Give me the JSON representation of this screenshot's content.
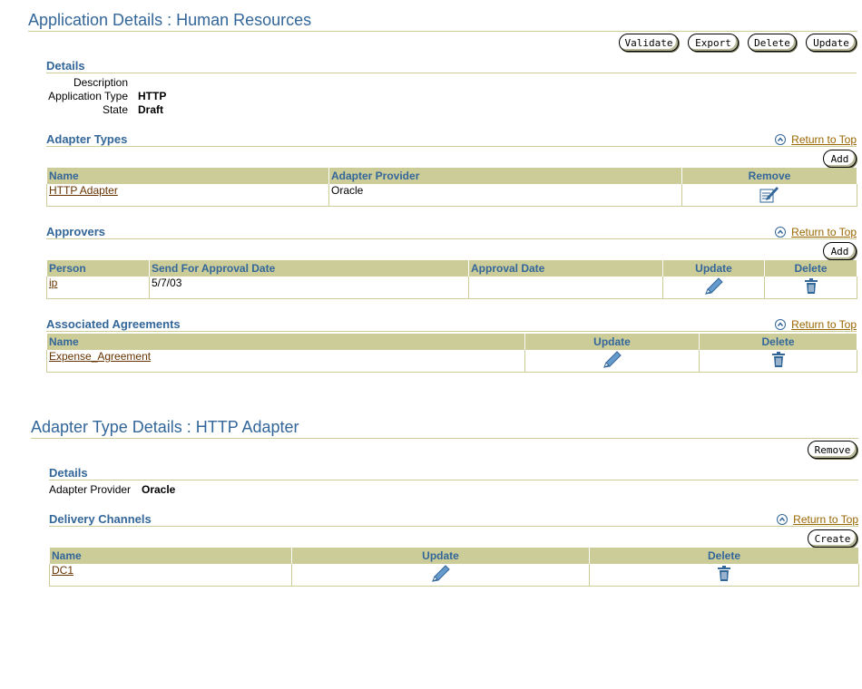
{
  "app_details": {
    "title": "Application Details : Human Resources",
    "buttons": {
      "validate": "Validate",
      "export": "Export",
      "delete": "Delete",
      "update": "Update"
    },
    "details": {
      "header": "Details",
      "description_label": "Description",
      "description_value": "",
      "type_label": "Application Type",
      "type_value": "HTTP",
      "state_label": "State",
      "state_value": "Draft"
    },
    "adapter_types": {
      "header": "Adapter Types",
      "return_to_top": "Return to Top",
      "add": "Add",
      "columns": [
        "Name",
        "Adapter Provider",
        "Remove"
      ],
      "rows": [
        {
          "name": "HTTP Adapter",
          "provider": "Oracle"
        }
      ]
    },
    "approvers": {
      "header": "Approvers",
      "return_to_top": "Return to Top",
      "add": "Add",
      "columns": [
        "Person",
        "Send For Approval Date",
        "Approval Date",
        "Update",
        "Delete"
      ],
      "rows": [
        {
          "person": "ip",
          "send_date": "5/7/03",
          "approval_date": ""
        }
      ]
    },
    "agreements": {
      "header": "Associated Agreements",
      "return_to_top": "Return to Top",
      "columns": [
        "Name",
        "Update",
        "Delete"
      ],
      "rows": [
        {
          "name": "Expense_Agreement"
        }
      ]
    }
  },
  "adapter_details": {
    "title": "Adapter Type Details : HTTP Adapter",
    "remove": "Remove",
    "details": {
      "header": "Details",
      "provider_label": "Adapter Provider",
      "provider_value": "Oracle"
    },
    "channels": {
      "header": "Delivery Channels",
      "return_to_top": "Return to Top",
      "create": "Create",
      "columns": [
        "Name",
        "Update",
        "Delete"
      ],
      "rows": [
        {
          "name": "DC1"
        }
      ]
    }
  },
  "colors": {
    "title": "#336699",
    "rule": "#cccc99",
    "header_bg": "#cccc99",
    "link": "#996600"
  },
  "icons": {
    "update": "pencil-icon",
    "delete": "trash-icon",
    "remove": "edit-form-icon",
    "return": "up-arrow-icon"
  }
}
